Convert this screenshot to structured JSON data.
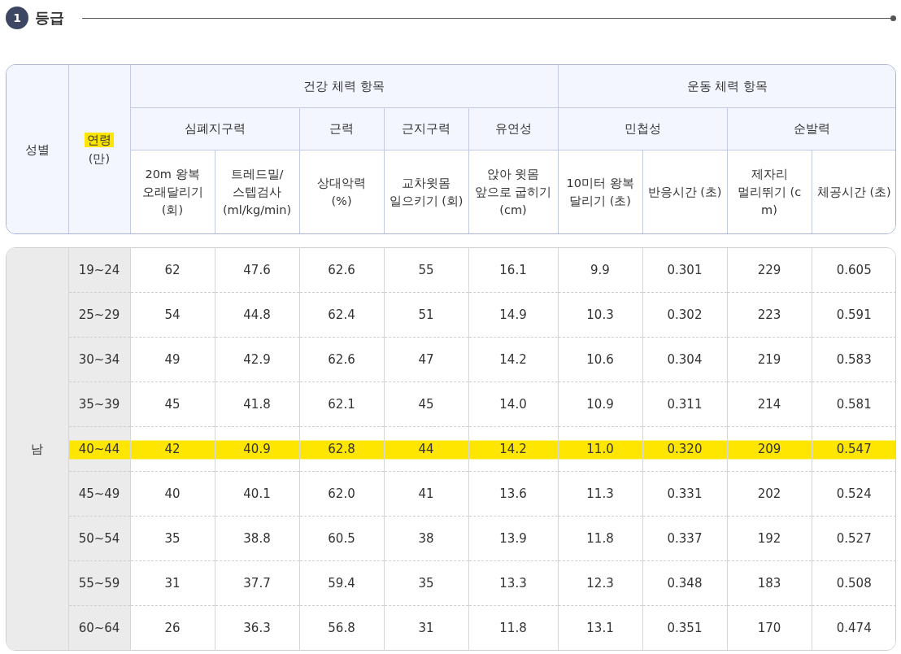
{
  "section": {
    "number": "1",
    "title": "등급"
  },
  "header": {
    "gender": "성별",
    "age": {
      "label": "연령",
      "unit": "(만)",
      "highlighted": true
    },
    "groups": [
      {
        "label": "건강 체력 항목",
        "items": [
          {
            "label": "심폐지구력",
            "columns": [
              "20m 왕복\n오래달리기\n(회)",
              "트레드밀/\n스텝검사\n(ml/kg/min)"
            ]
          },
          {
            "label": "근력",
            "columns": [
              "상대악력\n(%)"
            ]
          },
          {
            "label": "근지구력",
            "columns": [
              "교차윗몸\n일으키기 (회)"
            ]
          },
          {
            "label": "유연성",
            "columns": [
              "앉아 윗몸\n앞으로 굽히기\n(cm)"
            ]
          }
        ]
      },
      {
        "label": "운동 체력 항목",
        "items": [
          {
            "label": "민첩성",
            "columns": [
              "10미터 왕복\n달리기 (초)",
              "반응시간 (초)"
            ]
          },
          {
            "label": "순발력",
            "columns": [
              "제자리\n멀리뛰기 (c\nm)",
              "체공시간 (초)"
            ]
          }
        ]
      }
    ]
  },
  "gender": "남",
  "rows": [
    {
      "age": "19~24",
      "highlighted": false,
      "values": [
        "62",
        "47.6",
        "62.6",
        "55",
        "16.1",
        "9.9",
        "0.301",
        "229",
        "0.605"
      ]
    },
    {
      "age": "25~29",
      "highlighted": false,
      "values": [
        "54",
        "44.8",
        "62.4",
        "51",
        "14.9",
        "10.3",
        "0.302",
        "223",
        "0.591"
      ]
    },
    {
      "age": "30~34",
      "highlighted": false,
      "values": [
        "49",
        "42.9",
        "62.6",
        "47",
        "14.2",
        "10.6",
        "0.304",
        "219",
        "0.583"
      ]
    },
    {
      "age": "35~39",
      "highlighted": false,
      "values": [
        "45",
        "41.8",
        "62.1",
        "45",
        "14.0",
        "10.9",
        "0.311",
        "214",
        "0.581"
      ]
    },
    {
      "age": "40~44",
      "highlighted": true,
      "values": [
        "42",
        "40.9",
        "62.8",
        "44",
        "14.2",
        "11.0",
        "0.320",
        "209",
        "0.547"
      ]
    },
    {
      "age": "45~49",
      "highlighted": false,
      "values": [
        "40",
        "40.1",
        "62.0",
        "41",
        "13.6",
        "11.3",
        "0.331",
        "202",
        "0.524"
      ]
    },
    {
      "age": "50~54",
      "highlighted": false,
      "values": [
        "35",
        "38.8",
        "60.5",
        "38",
        "13.9",
        "11.8",
        "0.337",
        "192",
        "0.527"
      ]
    },
    {
      "age": "55~59",
      "highlighted": false,
      "values": [
        "31",
        "37.7",
        "59.4",
        "35",
        "13.3",
        "12.3",
        "0.348",
        "183",
        "0.508"
      ]
    },
    {
      "age": "60~64",
      "highlighted": false,
      "values": [
        "26",
        "36.3",
        "56.8",
        "31",
        "11.8",
        "13.1",
        "0.351",
        "170",
        "0.474"
      ]
    }
  ]
}
